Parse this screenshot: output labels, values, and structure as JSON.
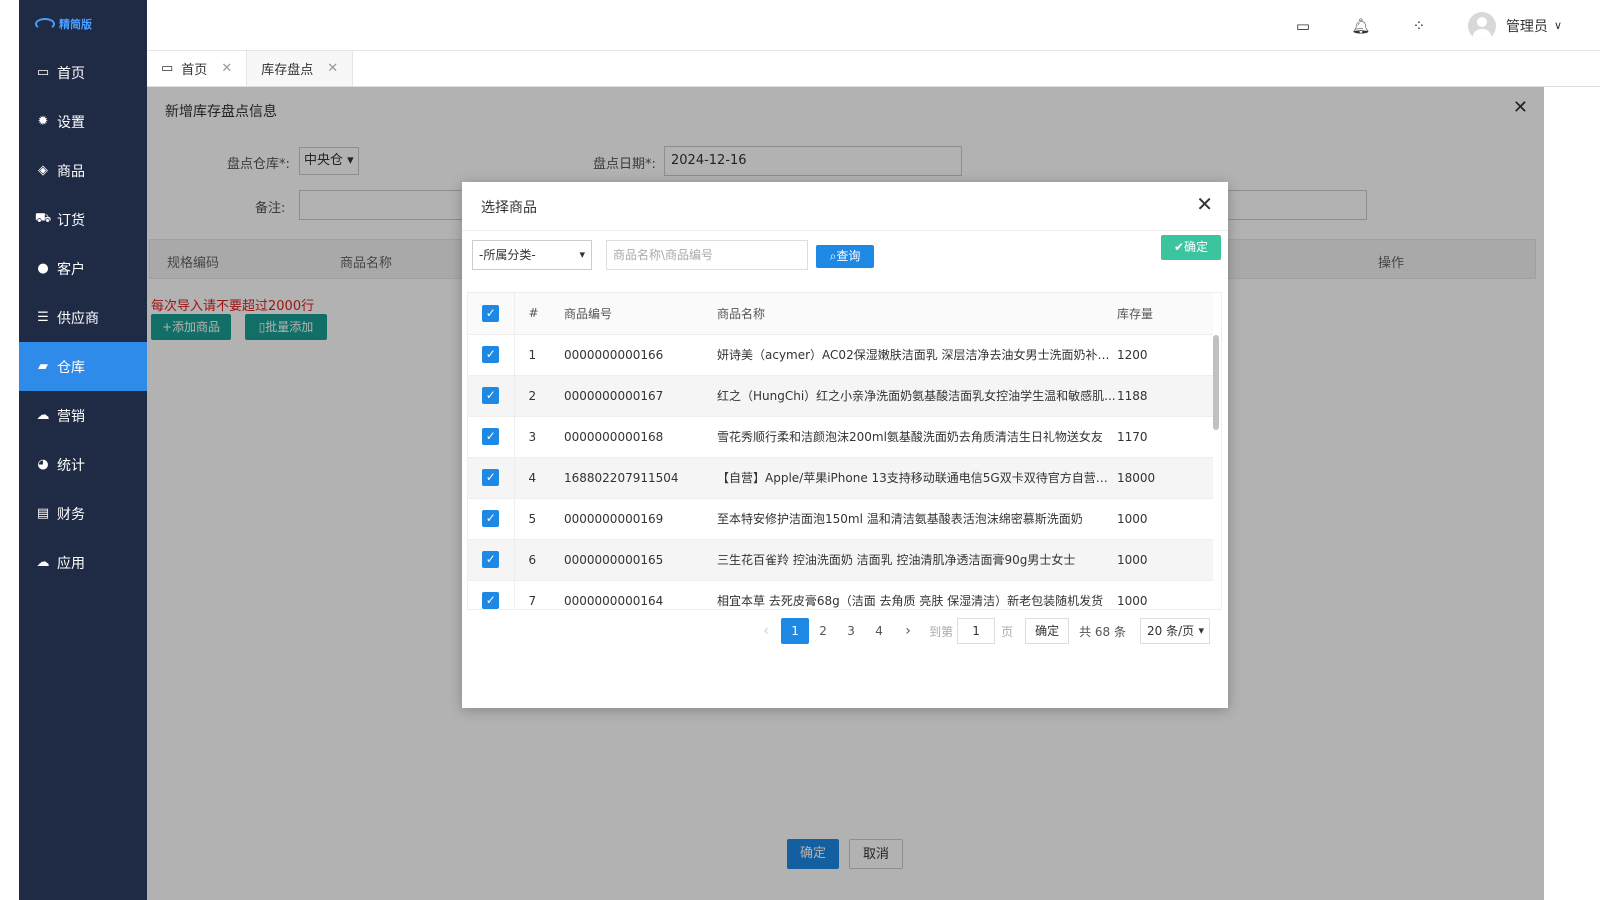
{
  "app": {
    "logo_text": "精简版"
  },
  "sidebar": {
    "items": [
      {
        "label": "首页",
        "icon": "monitor-icon"
      },
      {
        "label": "设置",
        "icon": "gear-icon"
      },
      {
        "label": "商品",
        "icon": "cube-icon"
      },
      {
        "label": "订货",
        "icon": "cart-icon"
      },
      {
        "label": "客户",
        "icon": "user-icon"
      },
      {
        "label": "供应商",
        "icon": "server-icon"
      },
      {
        "label": "仓库",
        "icon": "truck-icon"
      },
      {
        "label": "营销",
        "icon": "cloud-icon"
      },
      {
        "label": "统计",
        "icon": "pie-chart-icon"
      },
      {
        "label": "财务",
        "icon": "credit-card-icon"
      },
      {
        "label": "应用",
        "icon": "cloud-icon"
      }
    ],
    "active_index": 6
  },
  "header": {
    "user_name": "管理员"
  },
  "tabs": [
    {
      "label": "首页"
    },
    {
      "label": "库存盘点"
    }
  ],
  "panel": {
    "title": "新增库存盘点信息",
    "warehouse_label": "盘点仓库*:",
    "warehouse_value": "中央仓",
    "date_label": "盘点日期*:",
    "date_value": "2024-12-16",
    "note_label": "备注:",
    "grid_columns": {
      "spec_code": "规格编码",
      "product_name": "商品名称",
      "action": "操作"
    },
    "warning": "每次导入请不要超过2000行",
    "add_product": "添加商品",
    "batch_add": "批量添加",
    "confirm": "确定",
    "cancel": "取消"
  },
  "modal": {
    "title": "选择商品",
    "category_placeholder": "-所属分类-",
    "search_placeholder": "商品名称\\商品编号",
    "query_label": "查询",
    "confirm_label": "确定",
    "columns": {
      "index": "#",
      "code": "商品编号",
      "name": "商品名称",
      "stock": "库存量"
    },
    "rows": [
      {
        "index": "1",
        "code": "0000000000166",
        "name": "妍诗美（acymer）AC02保湿嫩肤洁面乳 深层洁净去油女男士洗面奶补水...",
        "stock": "1200"
      },
      {
        "index": "2",
        "code": "0000000000167",
        "name": "红之（HungChi）红之小亲净洗面奶氨基酸洁面乳女控油学生温和敏感肌...",
        "stock": "1188"
      },
      {
        "index": "3",
        "code": "0000000000168",
        "name": "雪花秀顺行柔和洁颜泡沫200ml氨基酸洗面奶去角质清洁生日礼物送女友",
        "stock": "1170"
      },
      {
        "index": "4",
        "code": "168802207911504",
        "name": "【自营】Apple/苹果iPhone 13支持移动联通电信5G双卡双待官方自营正...",
        "stock": "18000"
      },
      {
        "index": "5",
        "code": "0000000000169",
        "name": "至本特安修护洁面泡150ml 温和清洁氨基酸表活泡沫绵密慕斯洗面奶",
        "stock": "1000"
      },
      {
        "index": "6",
        "code": "0000000000165",
        "name": "三生花百雀羚 控油洗面奶 洁面乳 控油清肌净透洁面膏90g男士女士",
        "stock": "1000"
      },
      {
        "index": "7",
        "code": "0000000000164",
        "name": "相宜本草 去死皮膏68g（洁面 去角质 亮肤 保湿清洁）新老包装随机发货",
        "stock": "1000"
      }
    ],
    "pagination": {
      "pages": [
        "1",
        "2",
        "3",
        "4"
      ],
      "current": "1",
      "goto_label": "到第",
      "goto_value": "1",
      "page_unit": "页",
      "goto_confirm": "确定",
      "total": "共 68 条",
      "page_size": "20 条/页"
    }
  }
}
